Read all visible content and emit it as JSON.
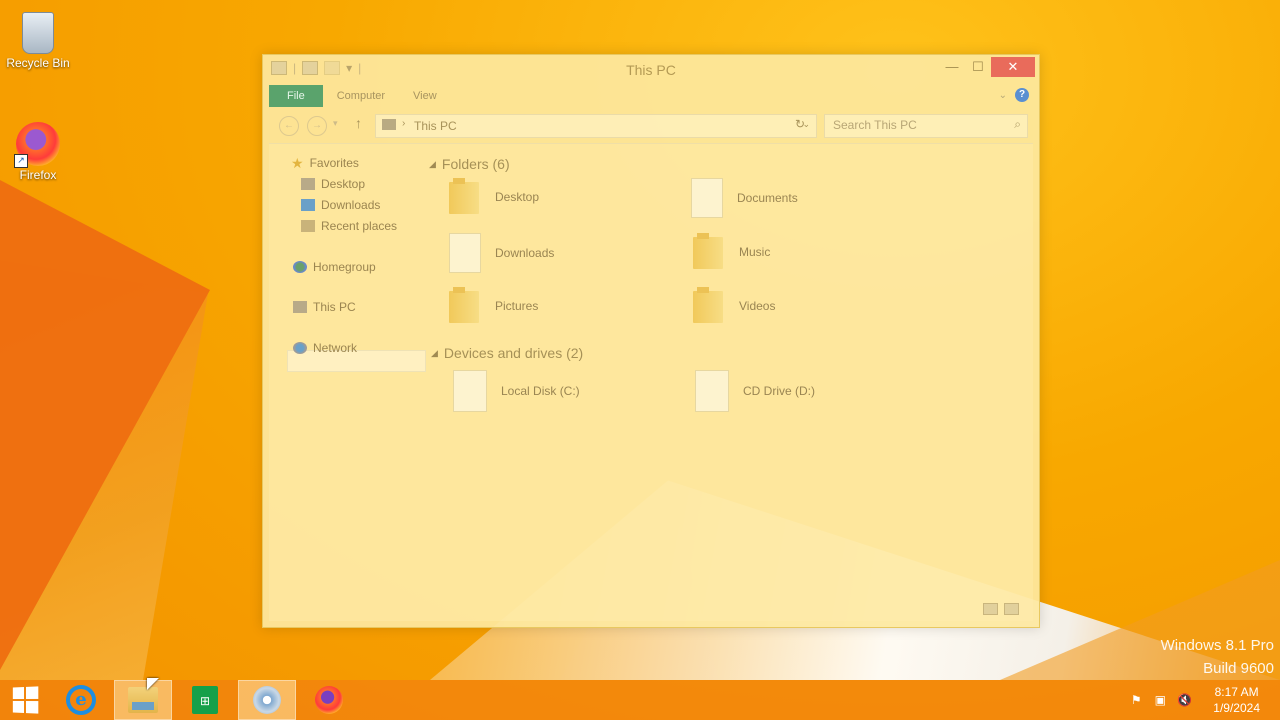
{
  "desktop": {
    "icons": [
      {
        "label": "Recycle Bin",
        "icon": "recycle-bin-icon"
      },
      {
        "label": "Firefox",
        "icon": "firefox-icon"
      }
    ],
    "watermark": {
      "line1": "Windows 8.1 Pro",
      "line2": "Build 9600"
    }
  },
  "window": {
    "title": "This PC",
    "tabs": [
      "File",
      "Computer",
      "View"
    ],
    "address": "This PC",
    "search_placeholder": "Search This PC",
    "nav": {
      "favorites": "Favorites",
      "favorites_items": [
        "Desktop",
        "Downloads",
        "Recent places"
      ],
      "homegroup": "Homegroup",
      "this_pc": "This PC",
      "network": "Network"
    },
    "folders_header": "Folders (6)",
    "folders": [
      "Desktop",
      "Documents",
      "Downloads",
      "Music",
      "Pictures",
      "Videos"
    ],
    "devices_header": "Devices and drives (2)",
    "devices": [
      "Local Disk (C:)",
      "CD Drive (D:)"
    ]
  },
  "taskbar": {
    "apps": [
      "Internet Explorer",
      "File Explorer",
      "Store",
      "DVD",
      "Firefox"
    ],
    "clock": {
      "time": "8:17 AM",
      "date": "1/9/2024"
    }
  },
  "colors": {
    "wallpaper": "#f7ab00",
    "file_tab": "#5aa36c",
    "close_button": "#e96b5b"
  }
}
